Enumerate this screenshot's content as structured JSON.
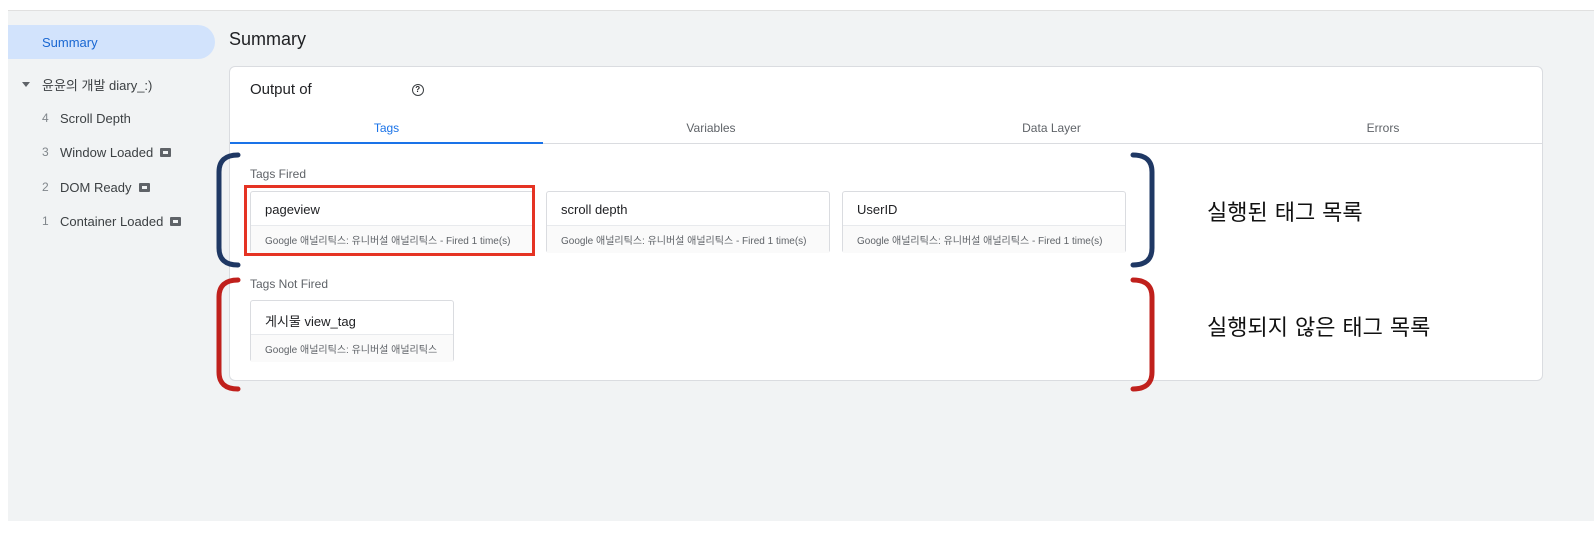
{
  "sidebar": {
    "summary_label": "Summary",
    "container_label": "윤윤의 개발 diary_:)",
    "events": [
      {
        "num": "4",
        "label": "Scroll Depth",
        "badge": false
      },
      {
        "num": "3",
        "label": "Window Loaded",
        "badge": true
      },
      {
        "num": "2",
        "label": "DOM Ready",
        "badge": true
      },
      {
        "num": "1",
        "label": "Container Loaded",
        "badge": true
      }
    ]
  },
  "main": {
    "title": "Summary",
    "output_label": "Output of",
    "tabs": [
      {
        "label": "Tags",
        "active": true
      },
      {
        "label": "Variables",
        "active": false
      },
      {
        "label": "Data Layer",
        "active": false
      },
      {
        "label": "Errors",
        "active": false
      }
    ],
    "tags_fired_label": "Tags Fired",
    "tags_fired": [
      {
        "name": "pageview",
        "detail": "Google 애널리틱스: 유니버설 애널리틱스 - Fired 1 time(s)"
      },
      {
        "name": "scroll depth",
        "detail": "Google 애널리틱스: 유니버설 애널리틱스 - Fired 1 time(s)"
      },
      {
        "name": "UserID",
        "detail": "Google 애널리틱스: 유니버설 애널리틱스 - Fired 1 time(s)"
      }
    ],
    "tags_not_fired_label": "Tags Not Fired",
    "tags_not_fired": [
      {
        "name": "게시물 view_tag",
        "detail": "Google 애널리틱스: 유니버설 애널리틱스"
      }
    ]
  },
  "annotations": {
    "fired": "실행된 태그 목록",
    "not_fired": "실행되지 않은 태그 목록"
  },
  "colors": {
    "highlight": "#e53323",
    "fired_bracket": "#1f3864",
    "not_fired_bracket": "#c0201c",
    "active_tab": "#1a73e8"
  }
}
